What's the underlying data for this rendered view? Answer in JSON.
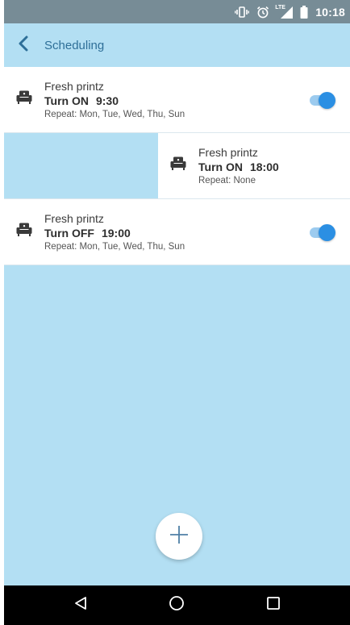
{
  "status_bar": {
    "time": "10:18",
    "icons": [
      "vibrate-icon",
      "alarm-icon",
      "lte-signal-icon",
      "battery-icon"
    ],
    "network_label": "LTE"
  },
  "app_bar": {
    "title": "Scheduling",
    "back_icon": "chevron-left-icon"
  },
  "colors": {
    "accent_blue": "#2b8fe3",
    "background": "#b3dff3",
    "title_color": "#2e6f98",
    "status_bar": "#778c96"
  },
  "schedules": [
    {
      "device": "Fresh printz",
      "action": "Turn ON",
      "time": "9:30",
      "repeat": "Repeat: Mon, Tue, Wed, Thu, Sun",
      "enabled": true,
      "icon": "sofa-icon"
    },
    {
      "device": "Fresh printz",
      "action": "Turn ON",
      "time": "18:00",
      "repeat": "Repeat: None",
      "swiped": true,
      "icon": "sofa-icon"
    },
    {
      "device": "Fresh printz",
      "action": "Turn OFF",
      "time": "19:00",
      "repeat": "Repeat: Mon, Tue, Wed, Thu, Sun",
      "enabled": true,
      "icon": "sofa-icon"
    }
  ],
  "fab": {
    "icon": "plus-icon"
  },
  "nav_bar": {
    "icons": [
      "back-triangle-icon",
      "home-circle-icon",
      "recents-square-icon"
    ]
  }
}
